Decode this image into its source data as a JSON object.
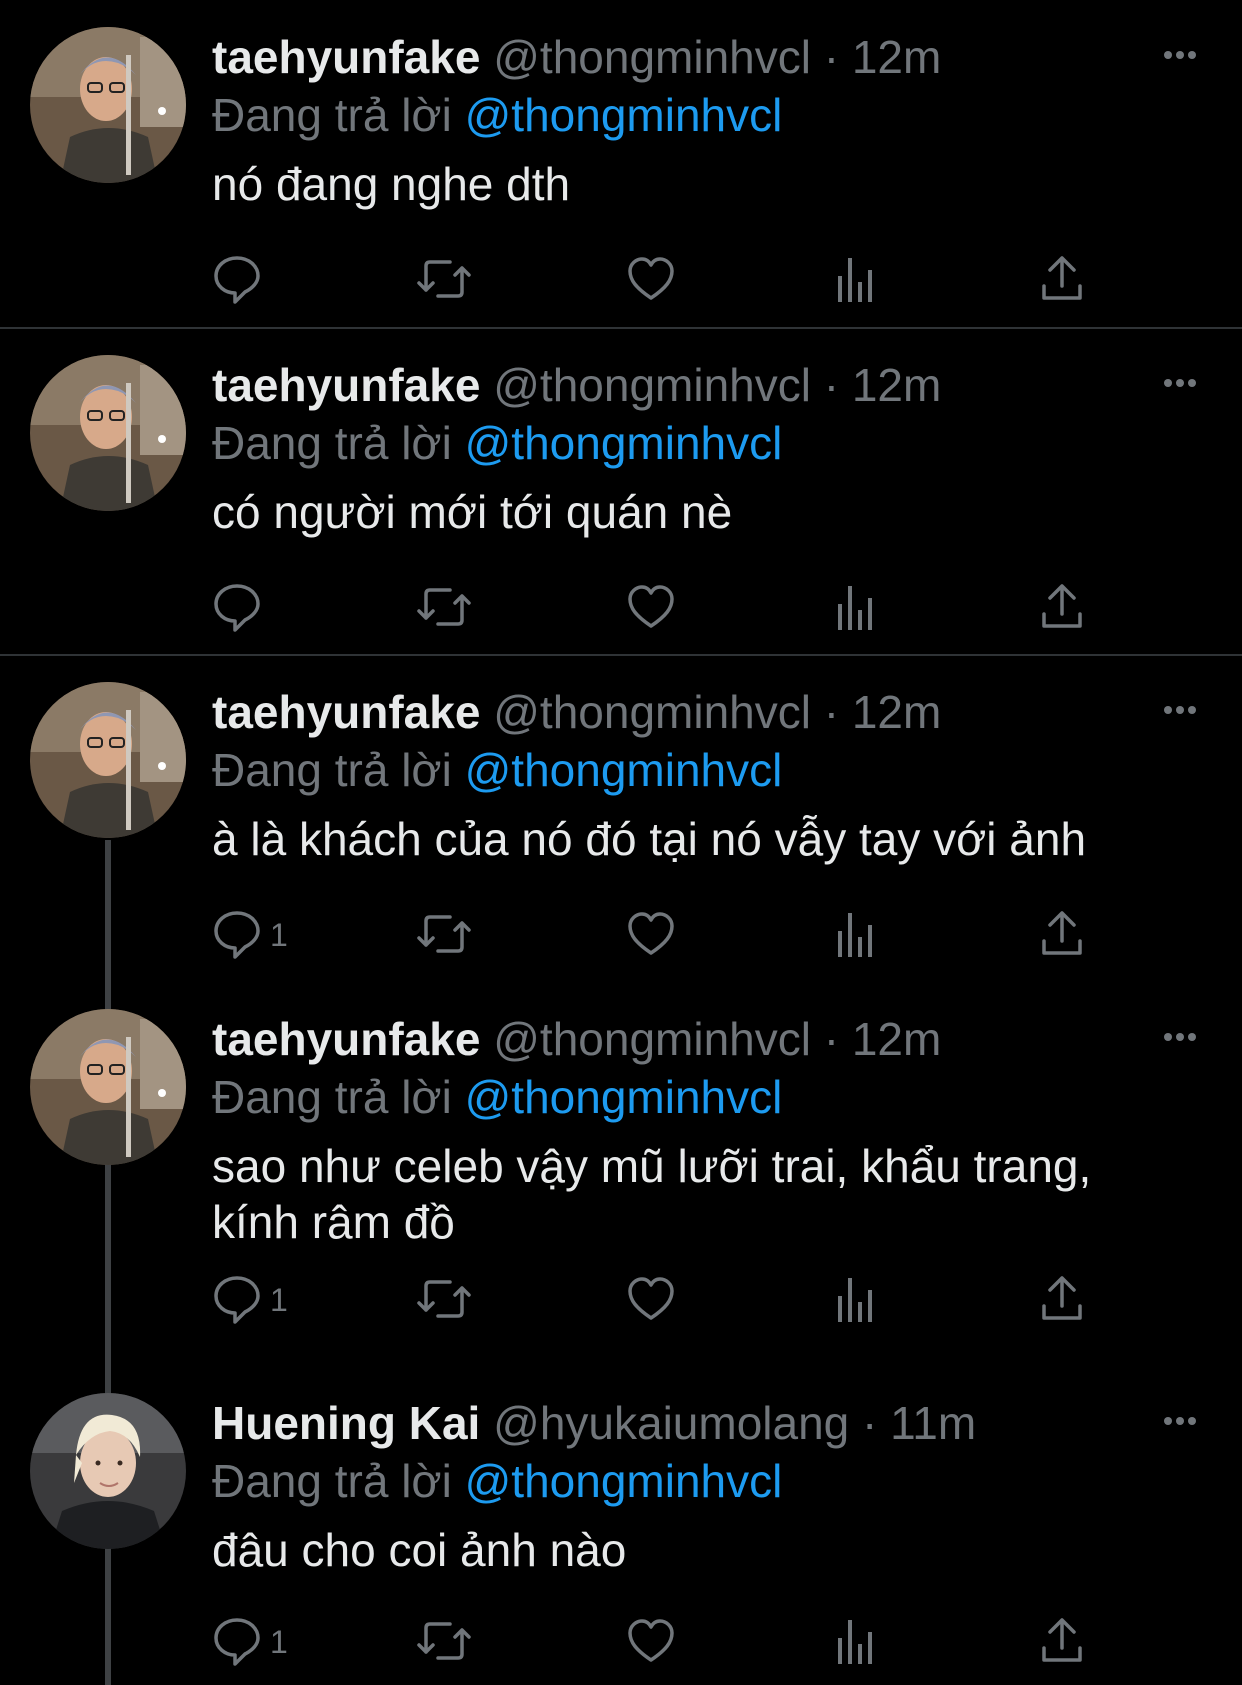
{
  "tweets": [
    {
      "name": "taehyunfake",
      "handle": "@thongminhvcl",
      "separator": "·",
      "time": "12m",
      "reply_prefix": "Đang trả lời",
      "reply_mention": "@thongminhvcl",
      "text": "nó đang nghe dth",
      "reply_count": ""
    },
    {
      "name": "taehyunfake",
      "handle": "@thongminhvcl",
      "separator": "·",
      "time": "12m",
      "reply_prefix": "Đang trả lời",
      "reply_mention": "@thongminhvcl",
      "text": "có người mới tới quán nè",
      "reply_count": ""
    },
    {
      "name": "taehyunfake",
      "handle": "@thongminhvcl",
      "separator": "·",
      "time": "12m",
      "reply_prefix": "Đang trả lời",
      "reply_mention": "@thongminhvcl",
      "text": "à là khách của nó đó tại nó vẫy tay với ảnh",
      "reply_count": "1"
    },
    {
      "name": "taehyunfake",
      "handle": "@thongminhvcl",
      "separator": "·",
      "time": "12m",
      "reply_prefix": "Đang trả lời",
      "reply_mention": "@thongminhvcl",
      "text": "sao như celeb vậy mũ lưỡi trai, khẩu trang, kính râm đồ",
      "reply_count": "1"
    },
    {
      "name": "Huening Kai",
      "handle": "@hyukaiumolang",
      "separator": "·",
      "time": "11m",
      "reply_prefix": "Đang trả lời",
      "reply_mention": "@thongminhvcl",
      "text": "đâu cho coi ảnh nào",
      "reply_count": "1"
    }
  ],
  "icons": {
    "reply": "reply-icon",
    "retweet": "retweet-icon",
    "like": "like-icon",
    "analytics": "analytics-icon",
    "share": "share-icon",
    "more": "more-icon"
  },
  "colors": {
    "background": "#000000",
    "text": "#e7e9ea",
    "muted": "#71767b",
    "mention": "#1d9bf0",
    "divider": "#2f3336"
  }
}
